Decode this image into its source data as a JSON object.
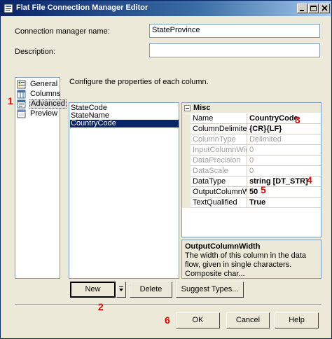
{
  "window": {
    "title": "Flat File Connection Manager Editor",
    "controls": [
      "minimize-icon",
      "maximize-icon",
      "close-icon"
    ]
  },
  "form": {
    "name_label": "Connection manager name:",
    "name_value": "StateProvince",
    "description_label": "Description:",
    "description_value": ""
  },
  "nav": {
    "items": [
      {
        "label": "General",
        "icon": "general-icon"
      },
      {
        "label": "Columns",
        "icon": "columns-icon"
      },
      {
        "label": "Advanced",
        "icon": "advanced-icon",
        "selected": true
      },
      {
        "label": "Preview",
        "icon": "preview-icon"
      }
    ]
  },
  "main": {
    "instructions": "Configure the properties of each column.",
    "columns": [
      "StateCode",
      "StateName",
      "CountryCode"
    ],
    "selected_column": "CountryCode",
    "category": "Misc",
    "properties": [
      {
        "name": "Name",
        "value": "CountryCode",
        "readonly": false
      },
      {
        "name": "ColumnDelimiter",
        "value": "{CR}{LF}",
        "readonly": false
      },
      {
        "name": "ColumnType",
        "value": "Delimited",
        "readonly": true
      },
      {
        "name": "InputColumnWidth",
        "value": "0",
        "readonly": true
      },
      {
        "name": "DataPrecision",
        "value": "0",
        "readonly": true
      },
      {
        "name": "DataScale",
        "value": "0",
        "readonly": true
      },
      {
        "name": "DataType",
        "value": "string [DT_STR]",
        "readonly": false
      },
      {
        "name": "OutputColumnWidth",
        "value": "50",
        "readonly": false
      },
      {
        "name": "TextQualified",
        "value": "True",
        "readonly": false
      }
    ],
    "description_title": "OutputColumnWidth",
    "description_text": "The width of this column in the data flow, given in single characters. Composite char..."
  },
  "buttons": {
    "new": "New",
    "delete": "Delete",
    "suggest": "Suggest Types...",
    "ok": "OK",
    "cancel": "Cancel",
    "help": "Help"
  },
  "annotations": [
    "1",
    "2",
    "3",
    "4",
    "5",
    "6"
  ],
  "colors": {
    "title_start": "#0a246a",
    "title_end": "#a6caf0",
    "selection": "#0a246a",
    "annotation": "#e00000",
    "dialog": "#ece9d8"
  }
}
